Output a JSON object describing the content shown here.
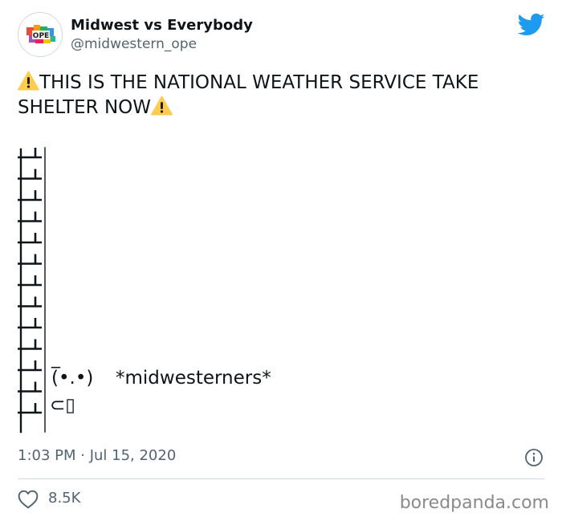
{
  "author": {
    "display_name": "Midwest vs Everybody",
    "handle": "@midwestern_ope",
    "avatar_text": "OPE"
  },
  "tweet": {
    "line1": "THIS IS THE NATIONAL WEATHER SERVICE TAKE",
    "line2": "SHELTER NOW",
    "ascii": {
      "face_top": "_",
      "face": "(•.•)",
      "caption": "*midwesterners*",
      "hands": "⊂▯"
    }
  },
  "meta": {
    "timestamp": "1:03 PM · Jul 15, 2020",
    "likes": "8.5K"
  },
  "watermark": "boredpanda.com",
  "colors": {
    "text": "#0f1419",
    "muted": "#536471",
    "twitter_blue": "#1d9bf0",
    "warning_yellow": "#ffcc4d",
    "divider": "#cfd9de"
  }
}
